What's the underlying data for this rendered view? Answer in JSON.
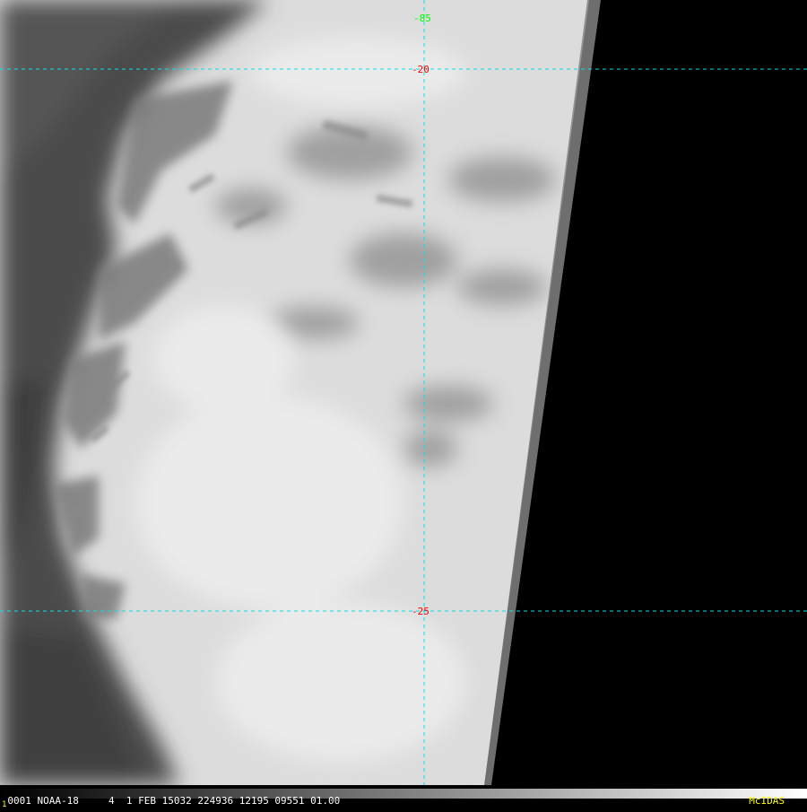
{
  "image": {
    "type": "satellite-infrared-cloud-image",
    "background_color": "#000000",
    "cloud_color": "#dcdcdc",
    "clear_sky_color": "#4a4a4a"
  },
  "graticule": {
    "line_color": "#00e5e5",
    "longitudes": [
      {
        "label": "-85",
        "color": "#00ff00"
      }
    ],
    "latitudes": [
      {
        "label": "-20",
        "color": "#ff0000"
      },
      {
        "label": "-25",
        "color": "#ff0000"
      }
    ]
  },
  "status_bar": {
    "frame_number": "1",
    "info_text": "0001 NOAA-18     4  1 FEB 15032 224936 12195 09551 01.00",
    "logo": "McIDAS",
    "logo_color": "#ffff00"
  }
}
